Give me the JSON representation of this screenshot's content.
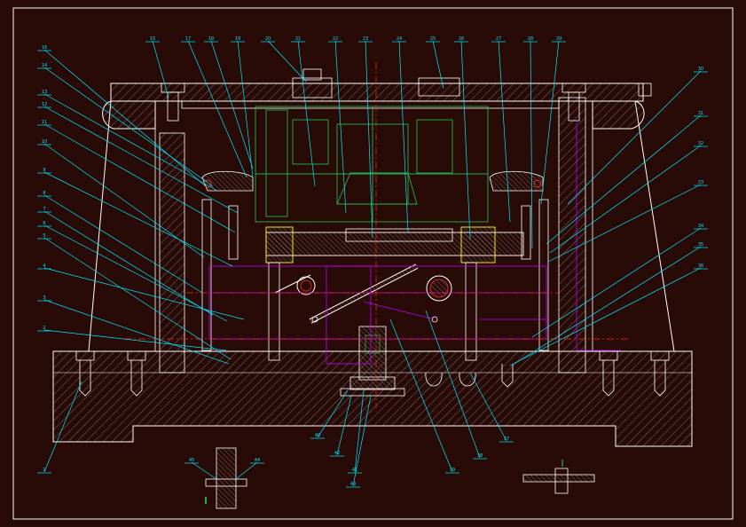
{
  "drawing": {
    "background_color": "#280b06",
    "colors": {
      "outline": "#ffffff",
      "leader": "#00e5ff",
      "center_line": "#ff2a2a",
      "hidden_line": "#c000ff",
      "die_part": "#22b14c",
      "highlight": "#ffff00",
      "hatch": "#9a9a9a"
    },
    "callouts_top": [
      "15",
      "17",
      "18",
      "19",
      "20",
      "21",
      "22",
      "23",
      "24",
      "25",
      "26",
      "27",
      "28",
      "29"
    ],
    "callouts_left": [
      "16",
      "14",
      "13",
      "12",
      "11",
      "10",
      "9",
      "8",
      "7",
      "6",
      "5",
      "4",
      "3",
      "2",
      "1"
    ],
    "callouts_right": [
      "30",
      "31",
      "32",
      "33",
      "34",
      "35",
      "36"
    ],
    "callouts_bottom": [
      "40",
      "42",
      "41",
      "43",
      "39",
      "38",
      "37"
    ],
    "callouts_detail": [
      "45",
      "44"
    ]
  }
}
